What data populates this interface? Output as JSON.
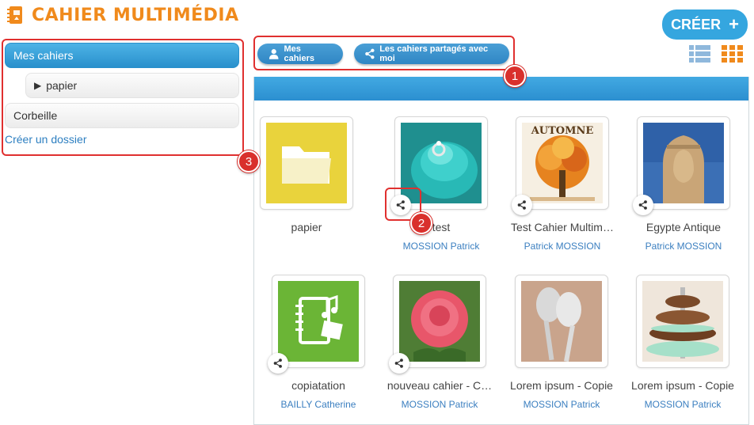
{
  "app": {
    "title": "CAHIER MULTIMÉDIA",
    "create_label": "CRÉER",
    "accent": "#35a6df",
    "brand_color": "#f08a1c"
  },
  "sidebar": {
    "items": [
      {
        "label": "Mes cahiers",
        "active": true
      },
      {
        "label": "papier",
        "expander": "▶"
      },
      {
        "label": "Corbeille"
      }
    ],
    "create_folder_label": "Créer un dossier"
  },
  "toolbar": {
    "my_notebooks_label": "Mes cahiers",
    "shared_label": "Les cahiers partagés avec moi",
    "views": [
      "list-view-icon",
      "grid-view-icon"
    ]
  },
  "cards": [
    {
      "name": "papier",
      "author": "",
      "image": "folder-icon",
      "shared": false
    },
    {
      "name": "test",
      "author": "MOSSION Patrick",
      "image": "cupcake-ring",
      "shared": true
    },
    {
      "name": "Test Cahier Multim…",
      "author": "Patrick MOSSION",
      "image": "autumn-tree",
      "shared": true
    },
    {
      "name": "Egypte Antique",
      "author": "Patrick MOSSION",
      "image": "sphinx",
      "shared": true
    },
    {
      "name": "copiatation",
      "author": "BAILLY Catherine",
      "image": "notebook-media-icon",
      "shared": true
    },
    {
      "name": "nouveau cahier - C…",
      "author": "MOSSION Patrick",
      "image": "rose",
      "shared": true
    },
    {
      "name": "Lorem ipsum - Copie",
      "author": "MOSSION Patrick",
      "image": "spoons",
      "shared": false
    },
    {
      "name": "Lorem ipsum - Copie",
      "author": "MOSSION Patrick",
      "image": "cupcake-tower",
      "shared": false
    }
  ],
  "annotations": [
    "1",
    "2",
    "3"
  ]
}
